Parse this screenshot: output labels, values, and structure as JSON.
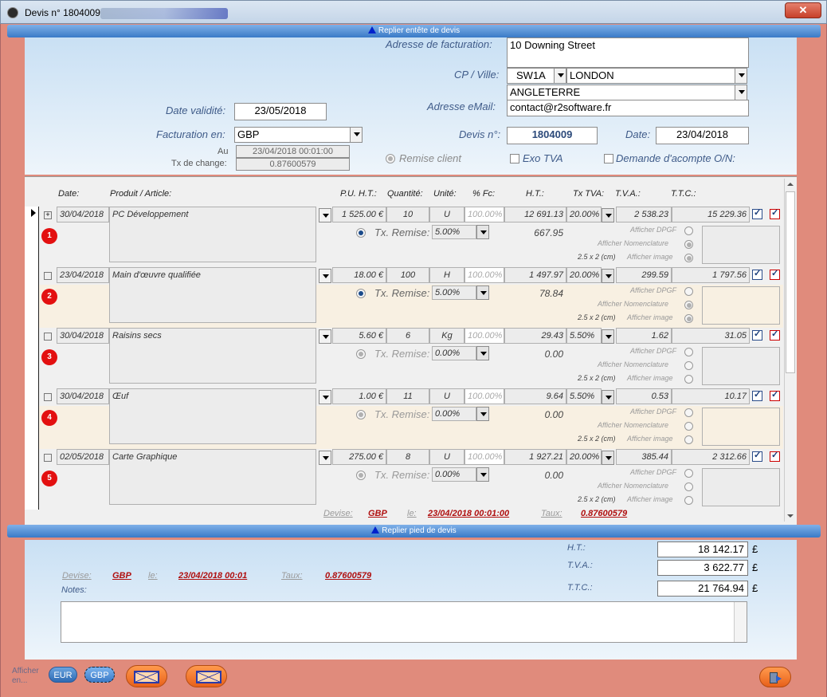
{
  "window": {
    "title": "Devis n° 1804009",
    "close": "✕"
  },
  "header": {
    "fold_label": "Replier entête de devis",
    "adresse_label": "Adresse de facturation:",
    "adresse": "10 Downing Street",
    "cp_label": "CP / Ville:",
    "cp": "SW1A",
    "ville": "LONDON",
    "pays": "ANGLETERRE",
    "email_label": "Adresse eMail:",
    "email": "contact@r2software.fr",
    "date_validite_label": "Date validité:",
    "date_validite": "23/05/2018",
    "facturation_label": "Facturation en:",
    "devise": "GBP",
    "au_label": "Au",
    "au_value": "23/04/2018 00:01:00",
    "tx_label": "Tx de change:",
    "tx_value": "0.87600579",
    "devis_label": "Devis n°:",
    "devis_num": "1804009",
    "date_label": "Date:",
    "date": "23/04/2018",
    "remise_client": "Remise client",
    "exo_tva": "Exo TVA",
    "acompte": "Demande d'acompte O/N:"
  },
  "columns": {
    "date": "Date:",
    "produit": "Produit / Article:",
    "pu": "P.U. H.T.:",
    "qte": "Quantité:",
    "unite": "Unité:",
    "fc": "% Fc:",
    "ht": "H.T.:",
    "txtva": "Tx TVA:",
    "tva": "T.V.A.:",
    "ttc": "T.T.C.:"
  },
  "line_labels": {
    "tx_remise": "Tx. Remise:",
    "afficher_dpgf": "Afficher DPGF",
    "afficher_nomenclature": "Afficher Nomenclature",
    "afficher_image": "Afficher image",
    "size": "2.5 x 2 (cm)",
    "marker_plus": "+"
  },
  "lines": [
    {
      "badge": "1",
      "date": "30/04/2018",
      "produit": "PC Développement",
      "pu": "1 525.00 €",
      "qte": "10",
      "unite": "U",
      "fc": "100.00%",
      "ht": "12 691.13",
      "txtva": "20.00%",
      "tva": "2 538.23",
      "ttc": "15 229.36",
      "remise": "5.00%",
      "remise_val": "667.95"
    },
    {
      "badge": "2",
      "date": "23/04/2018",
      "produit": "Main d'œuvre qualifiée",
      "pu": "18.00 €",
      "qte": "100",
      "unite": "H",
      "fc": "100.00%",
      "ht": "1 497.97",
      "txtva": "20.00%",
      "tva": "299.59",
      "ttc": "1 797.56",
      "remise": "5.00%",
      "remise_val": "78.84"
    },
    {
      "badge": "3",
      "date": "30/04/2018",
      "produit": "Raisins secs",
      "pu": "5.60 €",
      "qte": "6",
      "unite": "Kg",
      "fc": "100.00%",
      "ht": "29.43",
      "txtva": "5.50%",
      "tva": "1.62",
      "ttc": "31.05",
      "remise": "0.00%",
      "remise_val": "0.00"
    },
    {
      "badge": "4",
      "date": "30/04/2018",
      "produit": "Œuf",
      "pu": "1.00 €",
      "qte": "11",
      "unite": "U",
      "fc": "100.00%",
      "ht": "9.64",
      "txtva": "5.50%",
      "tva": "0.53",
      "ttc": "10.17",
      "remise": "0.00%",
      "remise_val": "0.00"
    },
    {
      "badge": "5",
      "date": "02/05/2018",
      "produit": "Carte Graphique",
      "pu": "275.00 €",
      "qte": "8",
      "unite": "U",
      "fc": "100.00%",
      "ht": "1 927.21",
      "txtva": "20.00%",
      "tva": "385.44",
      "ttc": "2 312.66",
      "remise": "0.00%",
      "remise_val": "0.00"
    }
  ],
  "devise_footer": {
    "devise_label": "Devise:",
    "devise": "GBP",
    "le_label": "le:",
    "le": "23/04/2018 00:01:00",
    "taux_label": "Taux:",
    "taux": "0.87600579"
  },
  "pied": {
    "fold_label": "Replier pied de devis",
    "devise_label": "Devise:",
    "devise": "GBP",
    "le_label": "le:",
    "le": "23/04/2018 00:01",
    "taux_label": "Taux:",
    "taux": "0.87600579",
    "notes_label": "Notes:",
    "ht_label": "H.T.:",
    "ht": "18 142.17",
    "tva_label": "T.V.A.:",
    "tva": "3 622.77",
    "ttc_label": "T.T.C.:",
    "ttc": "21 764.94",
    "currency": "£"
  },
  "bottom": {
    "afficher_label": "Afficher en...",
    "eur": "EUR",
    "gbp": "GBP"
  }
}
